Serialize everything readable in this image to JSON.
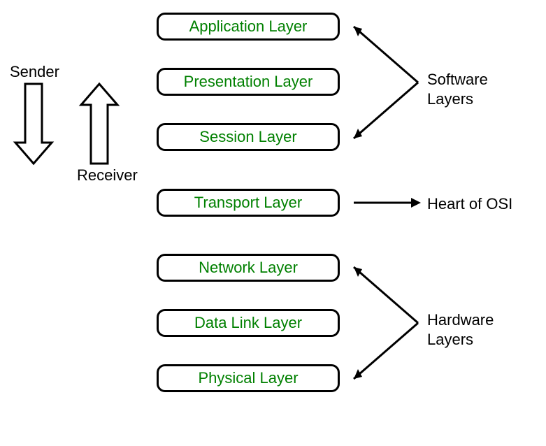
{
  "layers": {
    "l1": "Application Layer",
    "l2": "Presentation Layer",
    "l3": "Session Layer",
    "l4": "Transport Layer",
    "l5": "Network Layer",
    "l6": "Data Link Layer",
    "l7": "Physical Layer"
  },
  "labels": {
    "sender": "Sender",
    "receiver": "Receiver",
    "software": "Software\nLayers",
    "heart": "Heart of OSI",
    "hardware": "Hardware\nLayers"
  }
}
